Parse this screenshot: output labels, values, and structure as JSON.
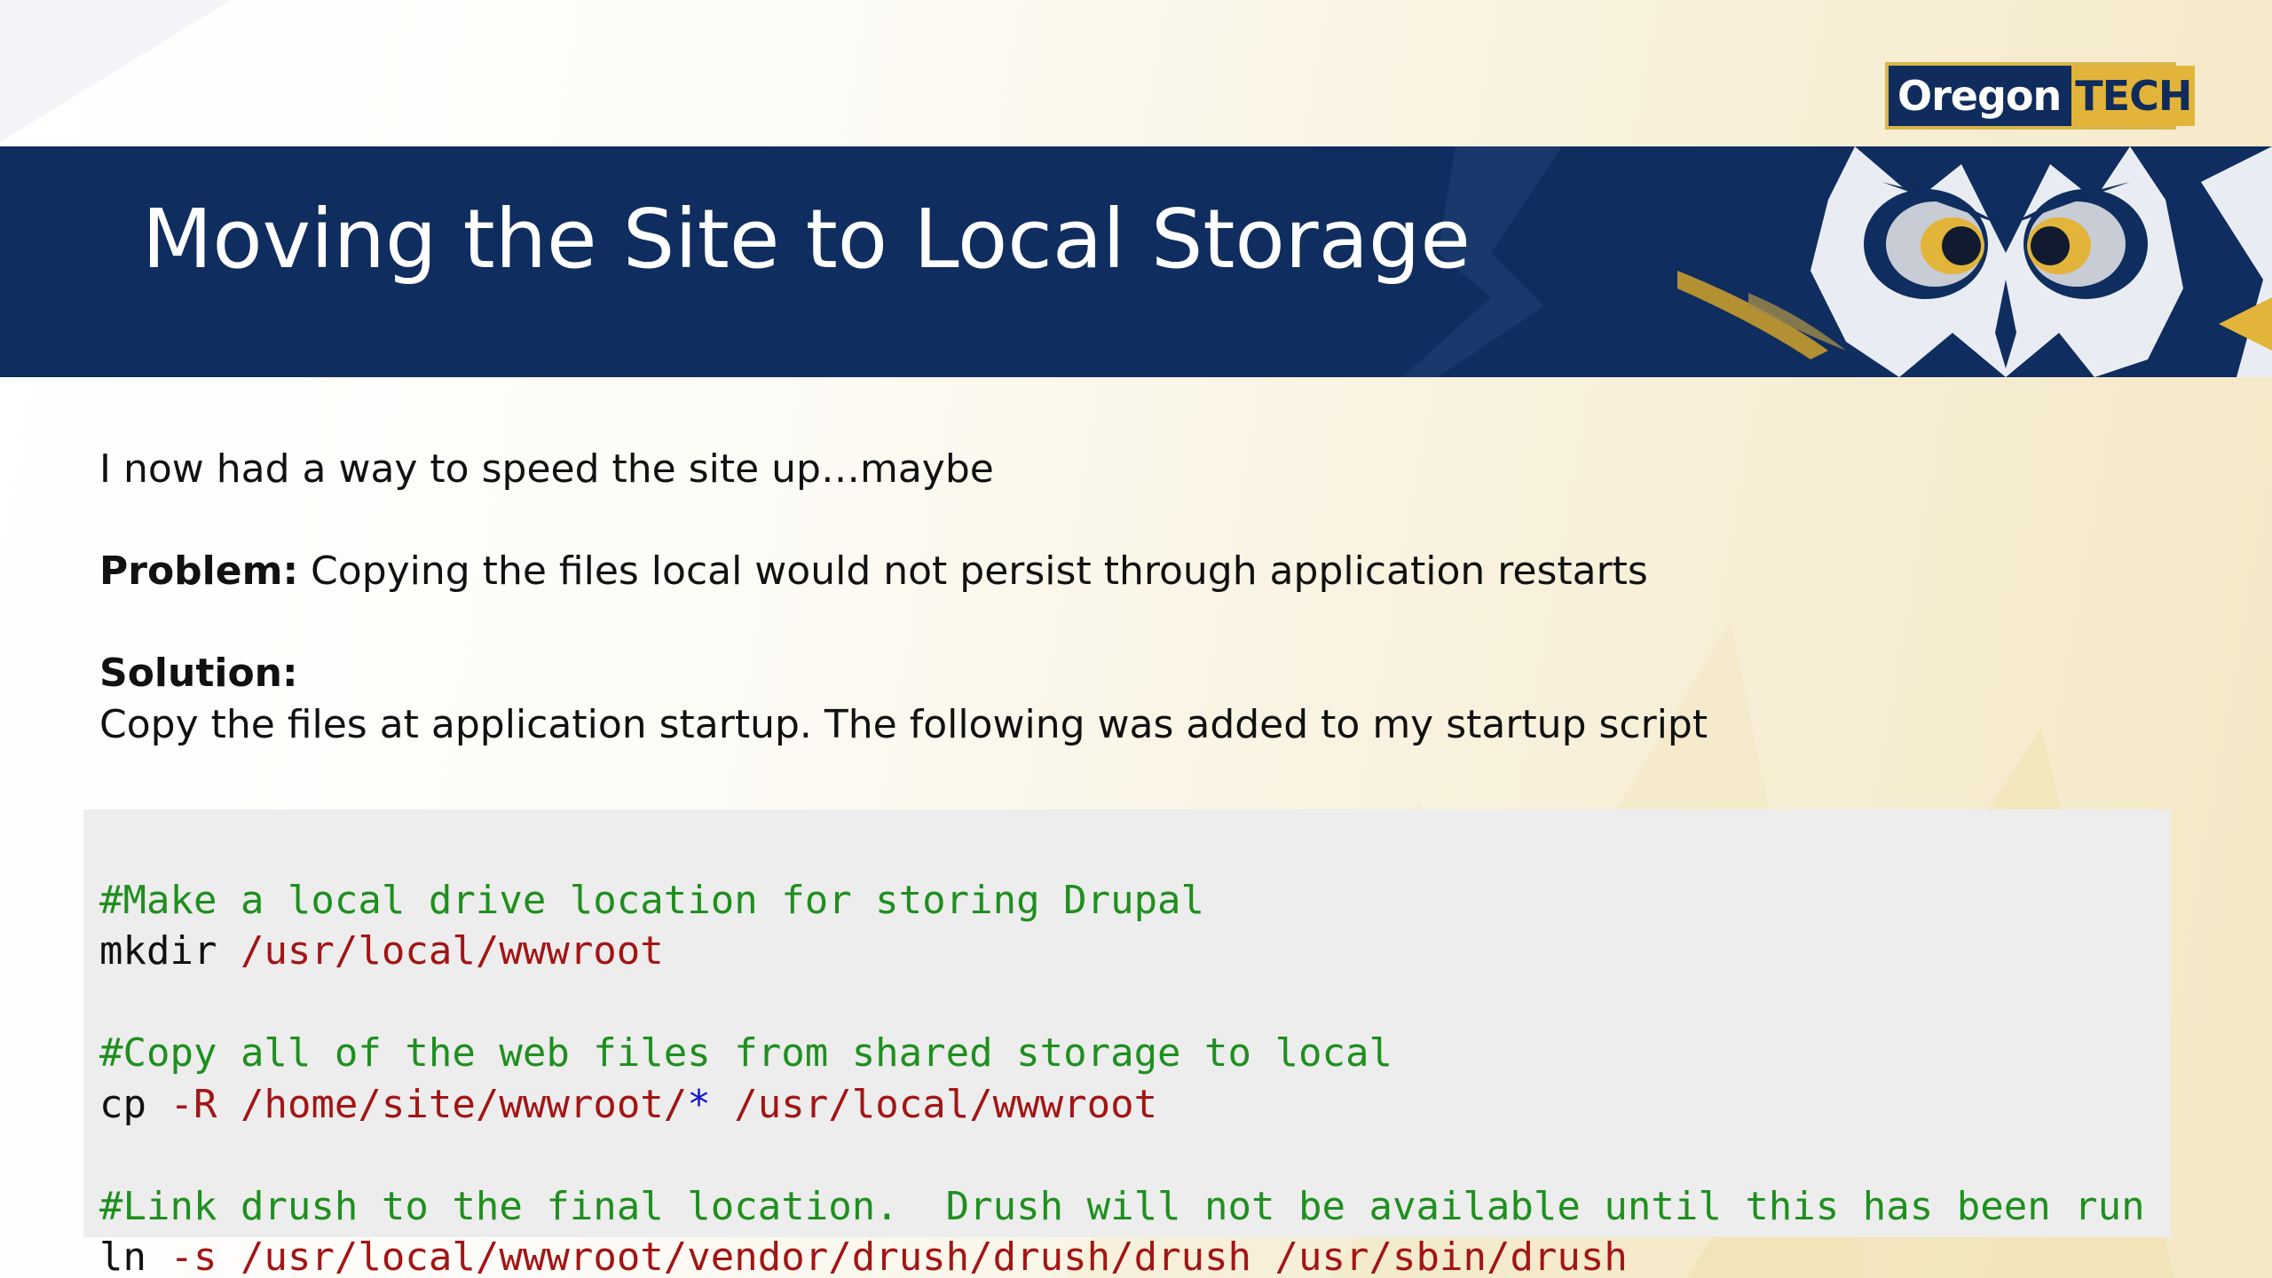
{
  "slide": {
    "logo": {
      "word": "Oregon",
      "accent": "TECH",
      "colors": {
        "navy": "#0f2c5c",
        "gold": "#e3b43a"
      }
    },
    "title": "Moving the Site to Local Storage",
    "intro": "I now had a way to speed the site up…maybe",
    "problem": {
      "label": "Problem:",
      "text": "Copying the files local would not persist through application restarts"
    },
    "solution": {
      "label": "Solution:",
      "text": "Copy the files at application startup.  The following was added to my startup script"
    },
    "code": {
      "block1": {
        "comment": "#Make a local drive location for storing Drupal",
        "cmd": "mkdir ",
        "arg": "/usr/local/wwwroot"
      },
      "block2": {
        "comment": "#Copy all of the web files from shared storage to local",
        "cmd": "cp ",
        "flag": "-R ",
        "src": "/home/site/wwwroot/",
        "glob": "*",
        "dest": " /usr/local/wwwroot"
      },
      "block3": {
        "comment": "#Link drush to the final location.  Drush will not be available until this has been run",
        "cmd": "ln ",
        "flag": "-s ",
        "args": "/usr/local/wwwroot/vendor/drush/drush/drush /usr/sbin/drush"
      },
      "colors": {
        "comment": "#1f8f1f",
        "path": "#a31515",
        "glob": "#1414d0"
      }
    },
    "colors": {
      "banner": "#0f2d5f",
      "background": "#f8f1dc"
    }
  }
}
